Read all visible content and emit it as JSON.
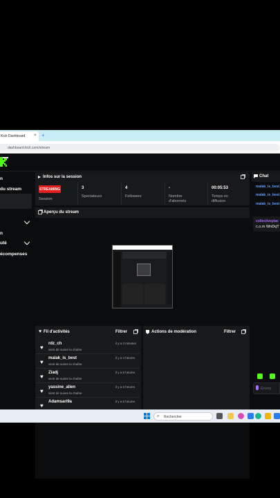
{
  "browser": {
    "tab_title": "Kick Dashboard",
    "tab_close": "×",
    "new_tab": "+",
    "url": "dashboard.kick.com/stream"
  },
  "sidebar": {
    "items": [
      {
        "label": "n"
      },
      {
        "label": "du stream"
      },
      {
        "label": "n"
      },
      {
        "label": "uté"
      },
      {
        "label": "écompenses"
      }
    ]
  },
  "session": {
    "title": "Infos sur la session",
    "status_badge": "STREAMING",
    "stats": [
      {
        "value": "",
        "label": "Session"
      },
      {
        "value": "3",
        "label": "Spectateurs"
      },
      {
        "value": "4",
        "label": "Followers"
      },
      {
        "value": "-",
        "label": "Nombre d'abonnés"
      },
      {
        "value": "00:05:53",
        "label": "Temps en diffusion"
      }
    ]
  },
  "preview": {
    "title": "Aperçu du stream"
  },
  "activity": {
    "title": "Fil d'activités",
    "filter_label": "Filtrer",
    "rows": [
      {
        "user": "rdz_ch",
        "text": "vient de suivre la chaîne",
        "time": "il y a 4 minutes"
      },
      {
        "user": "malak_is_best",
        "text": "vient de suivre la chaîne",
        "time": "il y a 4 heures"
      },
      {
        "user": "Ziadj",
        "text": "vient de suivre la chaîne",
        "time": "il y a 5 heures"
      },
      {
        "user": "yassine_alien",
        "text": "vient de suivre la chaîne",
        "time": "il y a 5 heures"
      },
      {
        "user": "Adamsari9a",
        "text": "",
        "time": "il y a 5 heures"
      }
    ]
  },
  "moderation": {
    "title": "Actions de modération",
    "filter_label": "Filtrer"
  },
  "chat": {
    "title": "Chat",
    "messages": [
      {
        "user": "malak_is_best"
      },
      {
        "user": "malak_is_best"
      },
      {
        "user": "malak_is_best"
      }
    ],
    "highlight_user": "collectiveplac",
    "highlight_text": "c.o.m WnDqT",
    "input_placeholder": "Envoy"
  },
  "taskbar": {
    "search_placeholder": "Rechercher"
  },
  "colors": {
    "accent_green": "#53fc18",
    "live_red": "#e01f1f",
    "chat_user_blue": "#61a0ff",
    "chat_highlight_purple": "#b16cff"
  }
}
